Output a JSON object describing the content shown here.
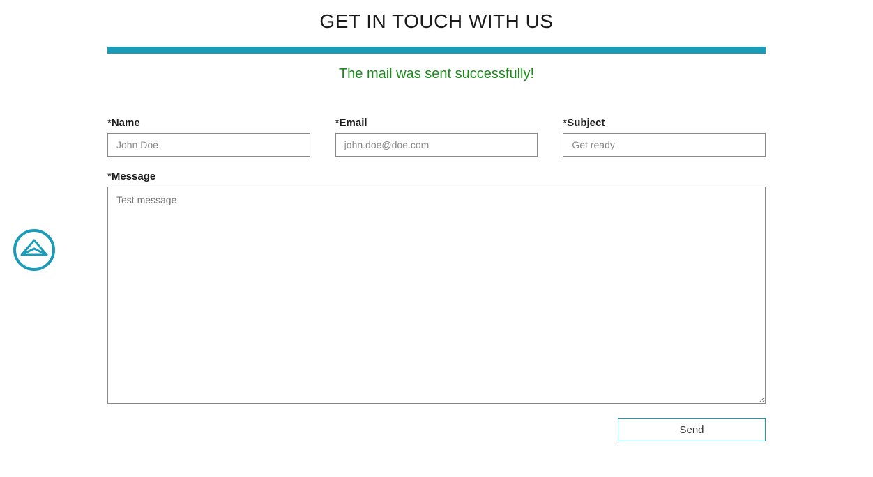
{
  "heading": "GET IN TOUCH WITH US",
  "success_message": "The mail was sent successfully!",
  "form": {
    "name": {
      "label": "Name",
      "placeholder": "John Doe",
      "value": ""
    },
    "email": {
      "label": "Email",
      "placeholder": "john.doe@doe.com",
      "value": ""
    },
    "subject": {
      "label": "Subject",
      "placeholder": "Get ready",
      "value": ""
    },
    "message": {
      "label": "Message",
      "placeholder": "Test message",
      "value": ""
    }
  },
  "send_button_label": "Send",
  "colors": {
    "accent": "#1a9cb9",
    "success": "#1a8a1a"
  }
}
